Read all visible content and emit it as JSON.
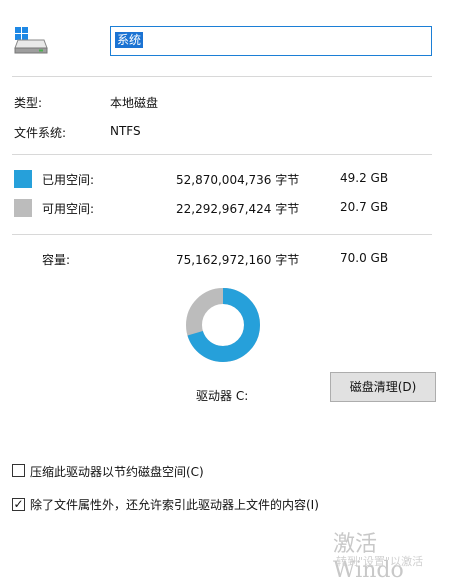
{
  "drive_icon": "hard-drive-icon",
  "name_input": {
    "value": "系统"
  },
  "type_label": "类型:",
  "type_value": "本地磁盘",
  "fs_label": "文件系统:",
  "fs_value": "NTFS",
  "used": {
    "label": "已用空间:",
    "bytes": "52,870,004,736 字节",
    "size": "49.2 GB",
    "color": "#26a0da"
  },
  "free": {
    "label": "可用空间:",
    "bytes": "22,292,967,424 字节",
    "size": "20.7 GB",
    "color": "#bcbcbc"
  },
  "capacity": {
    "label": "容量:",
    "bytes": "75,162,972,160 字节",
    "size": "70.0 GB"
  },
  "donut": {
    "used_fraction": 0.703
  },
  "drive_label": "驱动器 C:",
  "cleanup_button": "磁盘清理(D)",
  "compress_checkbox": {
    "label": "压缩此驱动器以节约磁盘空间(C)",
    "checked": false
  },
  "index_checkbox": {
    "label": "除了文件属性外，还允许索引此驱动器上文件的内容(I)",
    "checked": true
  },
  "watermark": {
    "line1": "激活 Windo",
    "line2": "转到\"设置\"以激活"
  }
}
